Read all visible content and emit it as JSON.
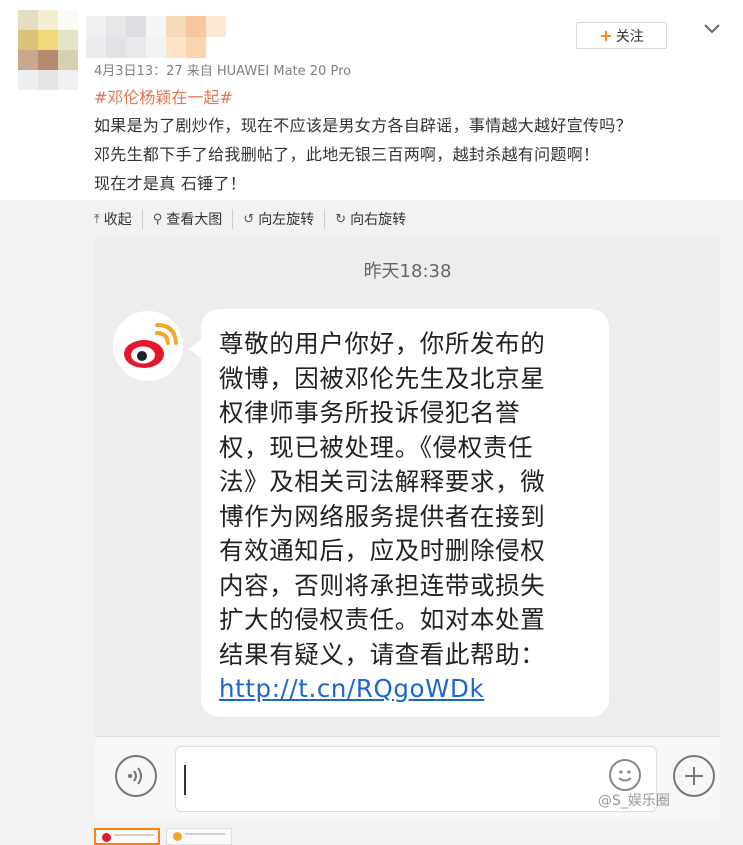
{
  "post": {
    "follow_label": "关注",
    "follow_plus": "+",
    "meta": "4月3日13：27 来自 HUAWEI Mate 20 Pro",
    "hashtag": "#邓伦杨颖在一起#",
    "lines": [
      "如果是为了剧炒作，现在不应该是男女方各自辟谣，事情越大越好宣传吗？",
      "邓先生都下手了给我删帖了，此地无银三百两啊，越封杀越有问题啊！",
      "现在才是真 石锤了！"
    ]
  },
  "toolbar": {
    "collapse": "收起",
    "collapse_icon": "⤒",
    "view_large": "查看大图",
    "view_large_icon": "⚲",
    "rotate_left": "向左旋转",
    "rotate_left_icon": "↺",
    "rotate_right": "向右旋转",
    "rotate_right_icon": "↻"
  },
  "screenshot": {
    "time": "昨天18:38",
    "message_lines": [
      "尊敬的用户你好，你所发布的",
      "微博，因被邓伦先生及北京星",
      "权律师事务所投诉侵犯名誉",
      "权，现已被处理。《侵权责任",
      "法》及相关司法解释要求，微",
      "博作为网络服务提供者在接到",
      "有效通知后，应及时删除侵权",
      "内容，否则将承担连带或损失",
      "扩大的侵权责任。如对本处置",
      "结果有疑义，请查看此帮助："
    ],
    "link": "http://t.cn/RQgoWDk"
  },
  "watermark": "@S_娱乐圈",
  "colors": {
    "accent_orange": "#ff8200",
    "hashtag": "#eb7350",
    "link_blue": "#1a68c9",
    "weibo_red": "#e6162d"
  }
}
